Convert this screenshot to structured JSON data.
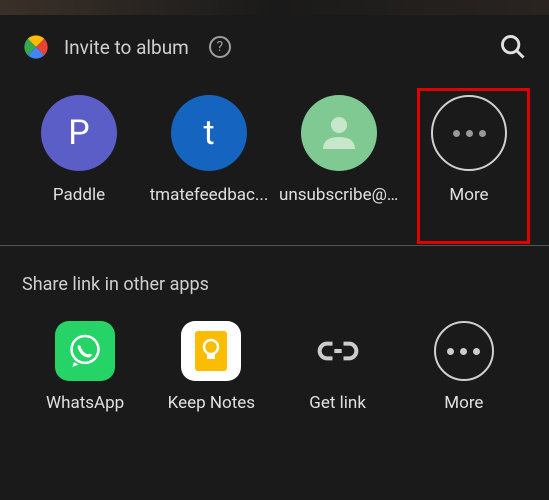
{
  "header": {
    "title": "Invite to album"
  },
  "contacts": [
    {
      "label": "Paddle",
      "initial": "P"
    },
    {
      "label": "tmatefeedbac...",
      "initial": "t"
    },
    {
      "label": "unsubscribe@..."
    },
    {
      "label": "More"
    }
  ],
  "share": {
    "title": "Share link in other apps",
    "apps": [
      {
        "label": "WhatsApp"
      },
      {
        "label": "Keep Notes"
      },
      {
        "label": "Get link"
      },
      {
        "label": "More"
      }
    ]
  }
}
